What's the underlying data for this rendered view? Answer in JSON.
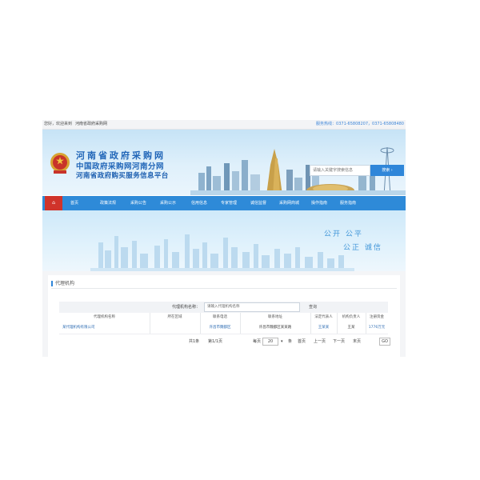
{
  "topbar": {
    "welcome": "您好，欢迎来到",
    "link": "河南省政府采购网",
    "contact": "服务热线：0371-65808207，0371-65808480"
  },
  "header": {
    "title_line1": "河南省政府采购网",
    "title_line2": "中国政府采购网河南分网",
    "title_line3": "河南省政府购买服务信息平台",
    "search_placeholder": "请输入关键字搜索信息",
    "search_button": "搜索 ›"
  },
  "nav": {
    "home_icon": "home-icon",
    "items": [
      "首页",
      "政策法规",
      "采购公告",
      "采购公示",
      "信用信息",
      "专家管理",
      "诚信监督",
      "采购网商城",
      "操作指南",
      "服务指南"
    ]
  },
  "banner": {
    "slogan_line1": "公开   公平",
    "slogan_line2": "公正   诚信"
  },
  "panel": {
    "title": "代理机构",
    "search_label": "代理机构名称：",
    "search_value": "请输入代理机构名称",
    "search_button": "查询"
  },
  "table": {
    "headers": [
      "代理机构名称",
      "所在区域",
      "联系电话",
      "联系地址",
      "法定代表人",
      "机构负责人",
      "注册资金"
    ],
    "rows": [
      [
        "某代理机构有限公司",
        "",
        "许昌市魏都区",
        "许昌市魏都区某某路",
        "王某某",
        "王某",
        "1776万元"
      ]
    ]
  },
  "pager": {
    "total": "共1条",
    "page": "第1/1页",
    "per_page_label": "每页",
    "per_page_value": "20",
    "per_page_unit": "条",
    "first": "首页",
    "prev": "上一页",
    "next": "下一页",
    "last": "末页",
    "go": "GO"
  },
  "colors": {
    "primary": "#2e8ad8",
    "home_red": "#d0332a",
    "title_blue": "#2166b8"
  }
}
